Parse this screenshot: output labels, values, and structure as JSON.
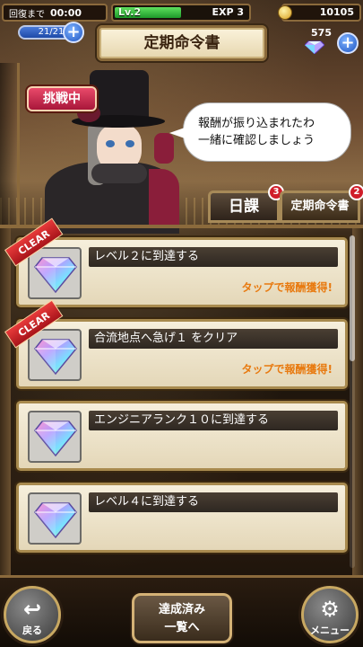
{
  "header": {
    "recovery_label": "回復まで",
    "recovery_time": "00:00",
    "stamina": "21/21",
    "level": "Lv.2",
    "exp": "EXP 3",
    "level_progress": 0.5,
    "coins": "10105",
    "gems": "575",
    "page_title": "定期命令書"
  },
  "hero": {
    "challenge_badge": "挑戦中",
    "speech_line1": "報酬が振り込まれたわ",
    "speech_line2": "一緒に確認しましょう"
  },
  "tabs": [
    {
      "label": "日課",
      "badge": "3"
    },
    {
      "label": "定期命令書",
      "badge": "2"
    }
  ],
  "missions": [
    {
      "name": "レベル２に到達する",
      "cleared": true,
      "clear_label": "CLEAR",
      "reward_text": "タップで報酬獲得!"
    },
    {
      "name": "合流地点へ急げ１ をクリア",
      "cleared": true,
      "clear_label": "CLEAR",
      "reward_text": "タップで報酬獲得!"
    },
    {
      "name": "エンジニアランク１０に到達する",
      "cleared": false,
      "reward_text": ""
    },
    {
      "name": "レベル４に到達する",
      "cleared": false,
      "reward_text": ""
    }
  ],
  "bottom": {
    "back_label": "戻る",
    "achieved_line1": "達成済み",
    "achieved_line2": "一覧へ",
    "menu_label": "メニュー"
  },
  "icons": {
    "back": "back-arrow-icon",
    "menu": "gear-icon",
    "gem": "rainbow-crystal-icon",
    "coin": "coin-icon"
  },
  "colors": {
    "reward_text": "#e87a10",
    "clear_ribbon": "#d8202a",
    "frame_gold": "#a88a4e",
    "level_green": "#3cc03c"
  }
}
